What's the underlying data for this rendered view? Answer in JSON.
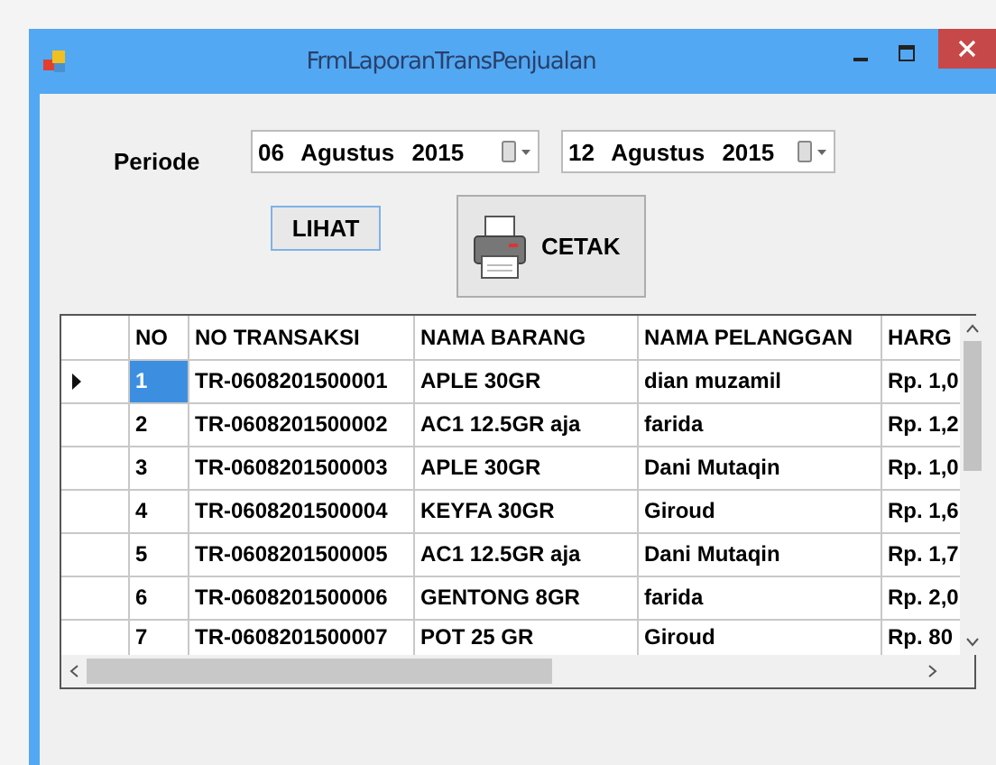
{
  "window": {
    "title": "FrmLaporanTransPenjualan"
  },
  "period": {
    "label": "Periode",
    "from": "06 Agustus 2015",
    "to": "12 Agustus 2015"
  },
  "buttons": {
    "view": "LIHAT",
    "print": "CETAK"
  },
  "table": {
    "columns": [
      "NO",
      "NO TRANSAKSI",
      "NAMA BARANG",
      "NAMA PELANGGAN",
      "HARG"
    ],
    "rows": [
      {
        "cells": [
          "1",
          "TR-0608201500001",
          "APLE 30GR",
          "dian muzamil",
          "Rp. 1,0"
        ],
        "selected": true
      },
      {
        "cells": [
          "2",
          "TR-0608201500002",
          "AC1 12.5GR aja",
          "farida",
          "Rp. 1,2"
        ],
        "selected": false
      },
      {
        "cells": [
          "3",
          "TR-0608201500003",
          "APLE 30GR",
          "Dani Mutaqin",
          "Rp. 1,0"
        ],
        "selected": false
      },
      {
        "cells": [
          "4",
          "TR-0608201500004",
          "KEYFA 30GR",
          "Giroud",
          "Rp. 1,6"
        ],
        "selected": false
      },
      {
        "cells": [
          "5",
          "TR-0608201500005",
          "AC1 12.5GR aja",
          "Dani Mutaqin",
          "Rp. 1,7"
        ],
        "selected": false
      },
      {
        "cells": [
          "6",
          "TR-0608201500006",
          "GENTONG 8GR",
          "farida",
          "Rp. 2,0"
        ],
        "selected": false
      },
      {
        "cells": [
          "7",
          "TR-0608201500007",
          "POT 25 GR",
          "Giroud",
          "Rp. 80"
        ],
        "selected": false
      }
    ]
  }
}
